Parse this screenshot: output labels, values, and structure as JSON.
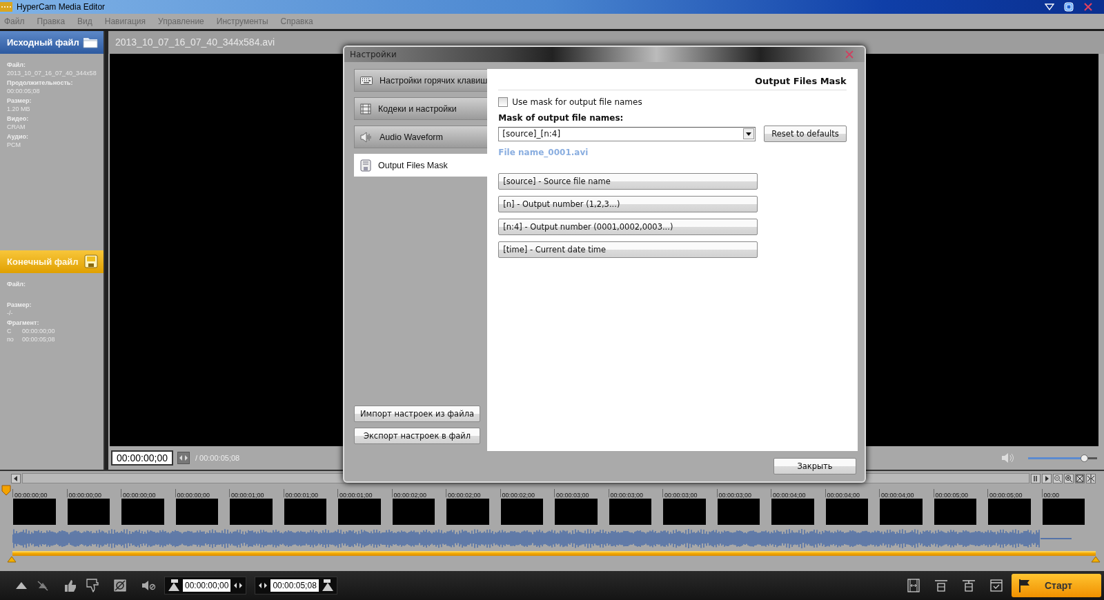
{
  "window": {
    "title": "HyperCam Media Editor"
  },
  "menu": [
    {
      "label": "Файл",
      "disabled": true
    },
    {
      "label": "Правка",
      "disabled": true
    },
    {
      "label": "Вид",
      "disabled": true
    },
    {
      "label": "Навигация",
      "disabled": true
    },
    {
      "label": "Управление",
      "disabled": true
    },
    {
      "label": "Инструменты",
      "disabled": true
    },
    {
      "label": "Справка",
      "disabled": true
    }
  ],
  "source_panel": {
    "title": "Исходный файл",
    "fields": [
      {
        "label": "Файл:",
        "value": "2013_10_07_16_07_40_344x58"
      },
      {
        "label": "Продолжительность:",
        "value": "00:00:05;08"
      },
      {
        "label": "Размер:",
        "value": "1.20 MB"
      },
      {
        "label": "Видео:",
        "value": "CRAM"
      },
      {
        "label": "Аудио:",
        "value": "PCM"
      }
    ]
  },
  "output_panel": {
    "title": "Конечный файл",
    "file_label": "Файл:",
    "size_label": "Размер:",
    "size_value": "-/-",
    "fragment_label": "Фрагмент:",
    "fragment": [
      {
        "prefix": "С",
        "time": "00:00:00;00"
      },
      {
        "prefix": "по",
        "time": "00:00:05;08"
      }
    ]
  },
  "player": {
    "file_name": "2013_10_07_16_07_40_344x584.avi",
    "current_time": "00:00:00;00",
    "total_time": "/ 00:00:05;08",
    "volume": {
      "level": 0.82
    }
  },
  "timeline": {
    "ticks": [
      {
        "label": "00:00:00;00"
      },
      {
        "label": "00:00:00;00"
      },
      {
        "label": "00:00:00;00"
      },
      {
        "label": "00:00:00;00"
      },
      {
        "label": "00:00:01;00"
      },
      {
        "label": "00:00:01;00"
      },
      {
        "label": "00:00:01;00"
      },
      {
        "label": "00:00:02;00"
      },
      {
        "label": "00:00:02;00"
      },
      {
        "label": "00:00:02;00"
      },
      {
        "label": "00:00:03;00"
      },
      {
        "label": "00:00:03;00"
      },
      {
        "label": "00:00:03;00"
      },
      {
        "label": "00:00:03;00"
      },
      {
        "label": "00:00:04;00"
      },
      {
        "label": "00:00:04;00"
      },
      {
        "label": "00:00:04;00"
      },
      {
        "label": "00:00:05;00"
      },
      {
        "label": "00:00:05;00"
      },
      {
        "label": "00:00"
      }
    ]
  },
  "toolbar": {
    "range_start": "00:00:00;00",
    "range_end": "00:00:05;08",
    "start_button": "Старт"
  },
  "dialog": {
    "title": "Настройки",
    "nav": [
      {
        "label": "Настройки горячих клавиш",
        "kind": "keyboard",
        "selected": false
      },
      {
        "label": "Кодеки и настройки",
        "kind": "film",
        "selected": false
      },
      {
        "label": "Audio Waveform",
        "kind": "speaker",
        "selected": false
      },
      {
        "label": "Output Files Mask",
        "kind": "floppy",
        "selected": true
      }
    ],
    "import_button": "Импорт настроек из файла",
    "export_button": "Экспорт настроек в файл",
    "section_title": "Output Files Mask",
    "use_mask": {
      "label": "Use mask for output file names",
      "checked": false
    },
    "mask_label": "Mask of output file names:",
    "mask_value": "[source]_[n:4]",
    "reset_button": "Reset to defaults",
    "preview": "File name_0001.avi",
    "tokens": [
      "[source] - Source file name",
      "[n] - Output number (1,2,3...)",
      "[n:4] - Output number (0001,0002,0003...)",
      "[time] - Current date time"
    ],
    "close_button": "Закрыть"
  }
}
